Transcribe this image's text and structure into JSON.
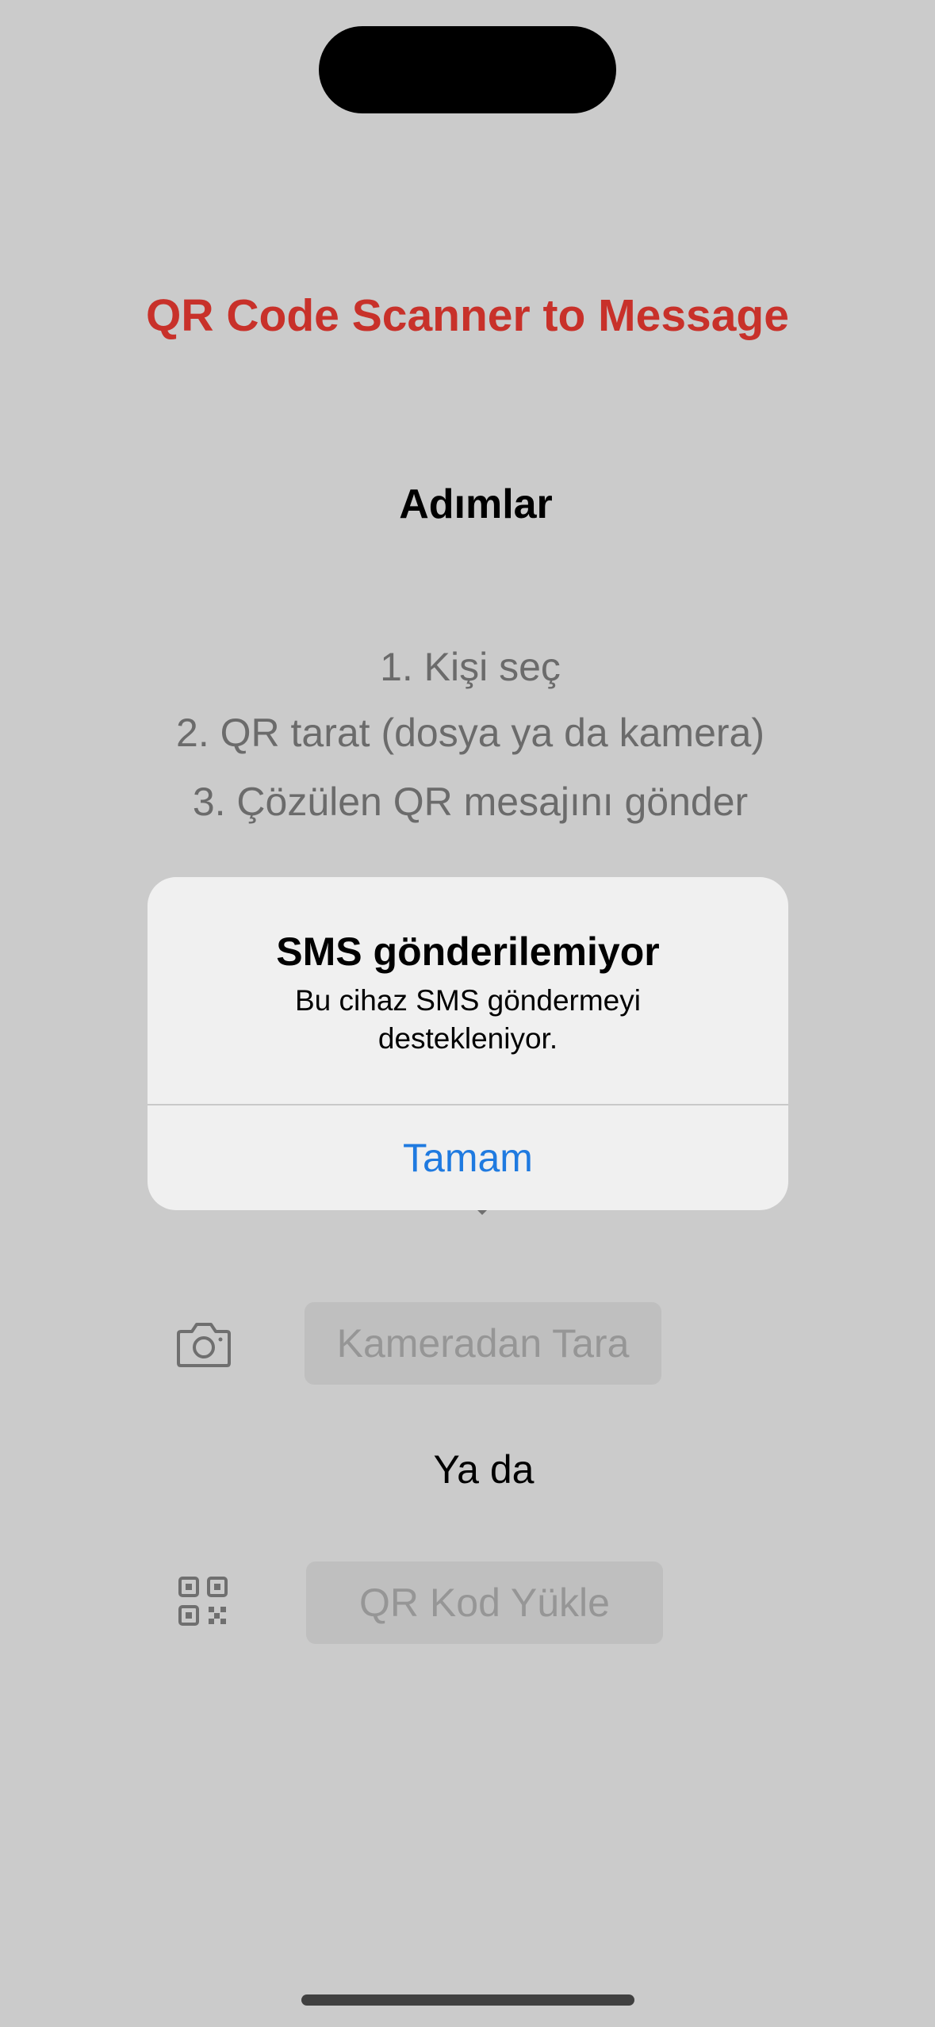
{
  "app": {
    "title": "QR Code Scanner to Message"
  },
  "steps": {
    "heading": "Adımlar",
    "items": [
      "1. Kişi seç",
      "2. QR tarat (dosya ya da kamera)",
      "3. Çözülen QR mesajını gönder"
    ]
  },
  "actions": {
    "camera_icon": "camera-icon",
    "camera_label": "Kameradan Tara",
    "or_label": "Ya da",
    "qr_icon": "qr-code-icon",
    "upload_label": "QR Kod Yükle"
  },
  "alert": {
    "title": "SMS gönderilemiyor",
    "message": "Bu cihaz SMS göndermeyi destekleniyor.",
    "ok_label": "Tamam"
  },
  "colors": {
    "title_red": "#c8312a",
    "dim_background": "#cbcbcb",
    "alert_button_blue": "#1f7ae0"
  }
}
